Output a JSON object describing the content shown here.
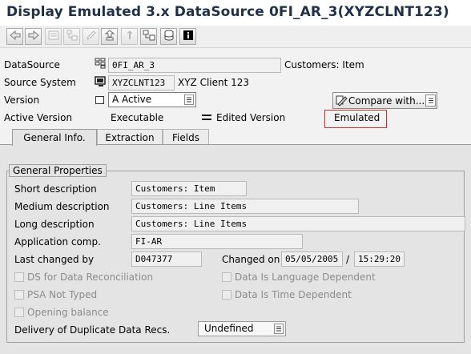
{
  "window": {
    "title": "Display Emulated 3.x DataSource 0FI_AR_3(XYZCLNT123)"
  },
  "toolbar": {
    "buttons": [
      {
        "icon": "back-arrow-icon"
      },
      {
        "icon": "forward-arrow-icon"
      },
      {
        "icon": "object-overview-icon"
      },
      {
        "icon": "hierarchy-icon"
      },
      {
        "icon": "change-pencil-icon"
      },
      {
        "icon": "activate-icon"
      },
      {
        "icon": "info-upload-icon"
      },
      {
        "icon": "technical-settings-icon"
      },
      {
        "icon": "database-icon"
      },
      {
        "icon": "information-icon"
      }
    ]
  },
  "header": {
    "datasource_label": "DataSource",
    "datasource_value": "0FI_AR_3",
    "datasource_desc": "Customers: Item",
    "source_system_label": "Source System",
    "source_system_value": "XYZCLNT123",
    "source_system_desc": "XYZ Client 123",
    "version_label": "Version",
    "version_value": "A Active",
    "compare_button": "Compare with...",
    "active_version_label": "Active Version",
    "active_version_value": "Executable",
    "edited_version_label": "Edited Version",
    "edited_version_value": "Emulated"
  },
  "tabs": [
    {
      "label": "General Info.",
      "active": true
    },
    {
      "label": "Extraction",
      "active": false
    },
    {
      "label": "Fields",
      "active": false
    }
  ],
  "general_properties": {
    "group_title": "General Properties",
    "short_description_label": "Short description",
    "short_description": "Customers: Item",
    "medium_description_label": "Medium description",
    "medium_description": "Customers: Line Items",
    "long_description_label": "Long description",
    "long_description": "Customers: Line Items",
    "application_comp_label": "Application comp.",
    "application_comp": "FI-AR",
    "last_changed_by_label": "Last changed by",
    "last_changed_by": "D047377",
    "changed_on_label": "Changed on",
    "changed_on_date": "05/05/2005",
    "date_time_separator": "/",
    "changed_on_time": "15:29:20",
    "checkboxes": [
      {
        "label": "DS for Data Reconciliation",
        "checked": false
      },
      {
        "label": "PSA Not Typed",
        "checked": false
      },
      {
        "label": "Opening balance",
        "checked": false
      },
      {
        "label": "Data Is Language Dependent",
        "checked": false
      },
      {
        "label": "Data Is Time Dependent",
        "checked": false
      }
    ],
    "delivery_label": "Delivery of Duplicate Data Recs.",
    "delivery_value": "Undefined"
  },
  "colors": {
    "title_text": "#1f3049",
    "highlight_border": "#c4302b",
    "panel_bg": "#e4e4e4"
  }
}
